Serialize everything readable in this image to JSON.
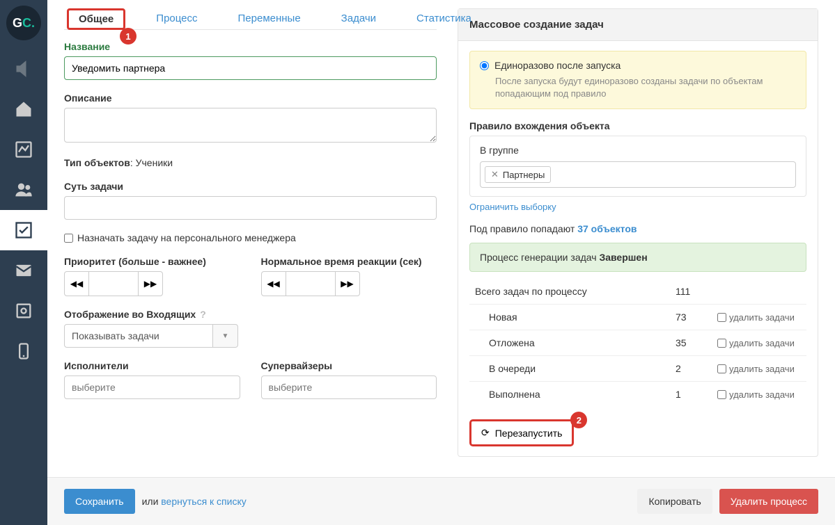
{
  "logo": "GC.",
  "tabs": [
    "Общее",
    "Процесс",
    "Переменные",
    "Задачи",
    "Статистика"
  ],
  "badges": {
    "tab": "1",
    "restart": "2"
  },
  "form": {
    "name_label": "Название",
    "name_value": "Уведомить партнера",
    "desc_label": "Описание",
    "desc_value": "",
    "type_label": "Тип объектов",
    "type_value": "Ученики",
    "essence_label": "Суть задачи",
    "essence_value": "",
    "checkbox_label": "Назначать задачу на персонального менеджера",
    "priority_label": "Приоритет (больше - важнее)",
    "reaction_label": "Нормальное время реакции (сек)",
    "inbox_label": "Отображение во Входящих",
    "inbox_value": "Показывать задачи",
    "performers_label": "Исполнители",
    "performers_placeholder": "выберите",
    "supervisors_label": "Супервайзеры",
    "supervisors_placeholder": "выберите"
  },
  "panel": {
    "title": "Массовое создание задач",
    "radio_label": "Единоразово после запуска",
    "radio_desc": "После запуска будут единоразово созданы задачи по объектам попадающим под правило",
    "rule_title": "Правило вхождения объекта",
    "rule_group_label": "В группе",
    "rule_tag": "Партнеры",
    "limit_link": "Ограничить выборку",
    "match_prefix": "Под правило попадают ",
    "match_count": "37 объектов",
    "status_prefix": "Процесс генерации задач ",
    "status_value": "Завершен",
    "table_head": {
      "label": "Всего задач по процессу",
      "count": "111"
    },
    "rows": [
      {
        "name": "Новая",
        "count": "73"
      },
      {
        "name": "Отложена",
        "count": "35"
      },
      {
        "name": "В очереди",
        "count": "2"
      },
      {
        "name": "Выполнена",
        "count": "1"
      }
    ],
    "delete_label": "удалить задачи",
    "restart_label": "Перезапустить"
  },
  "footer": {
    "save": "Сохранить",
    "or": "или ",
    "back": "вернуться к списку",
    "copy": "Копировать",
    "delete": "Удалить процесс"
  }
}
